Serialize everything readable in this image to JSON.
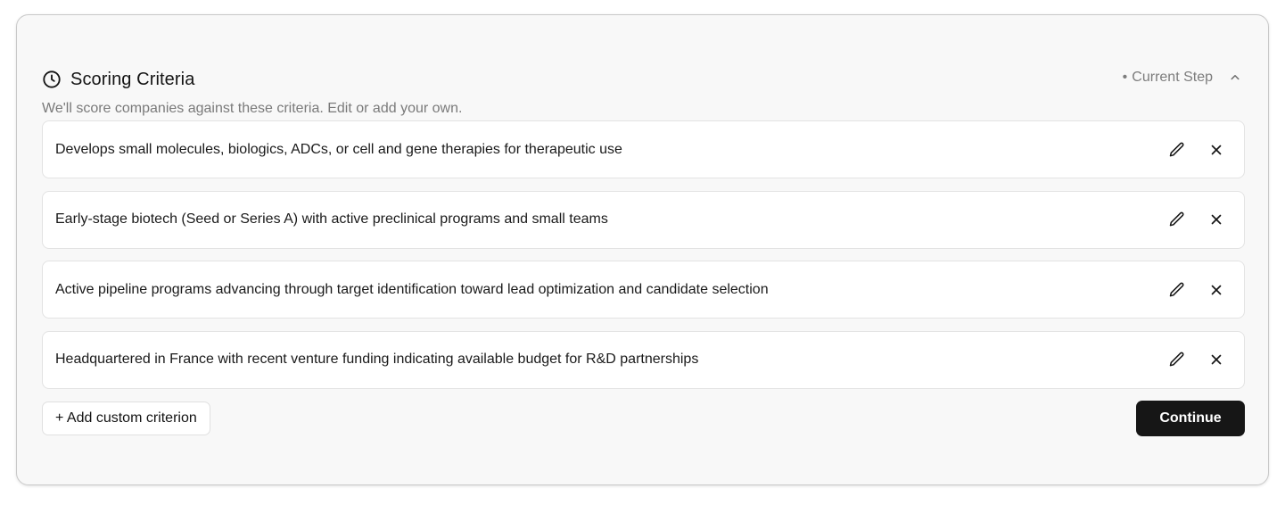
{
  "header": {
    "title": "Scoring Criteria",
    "icon": "clock-icon",
    "step_label": "Current Step",
    "collapse_icon": "chevron-up-icon"
  },
  "subtitle": "We'll score companies against these criteria. Edit or add your own.",
  "criteria": [
    {
      "text": "Develops small molecules, biologics, ADCs, or cell and gene therapies for therapeutic use"
    },
    {
      "text": "Early-stage biotech (Seed or Series A) with active preclinical programs and small teams"
    },
    {
      "text": "Active pipeline programs advancing through target identification toward lead optimization and candidate selection"
    },
    {
      "text": "Headquartered in France with recent venture funding indicating available budget for R&D partnerships"
    }
  ],
  "footer": {
    "add_label": "+ Add custom criterion",
    "continue_label": "Continue"
  },
  "colors": {
    "card_bg": "#f8f8f8",
    "primary_button": "#161616",
    "muted_text": "#7a7a7a"
  }
}
